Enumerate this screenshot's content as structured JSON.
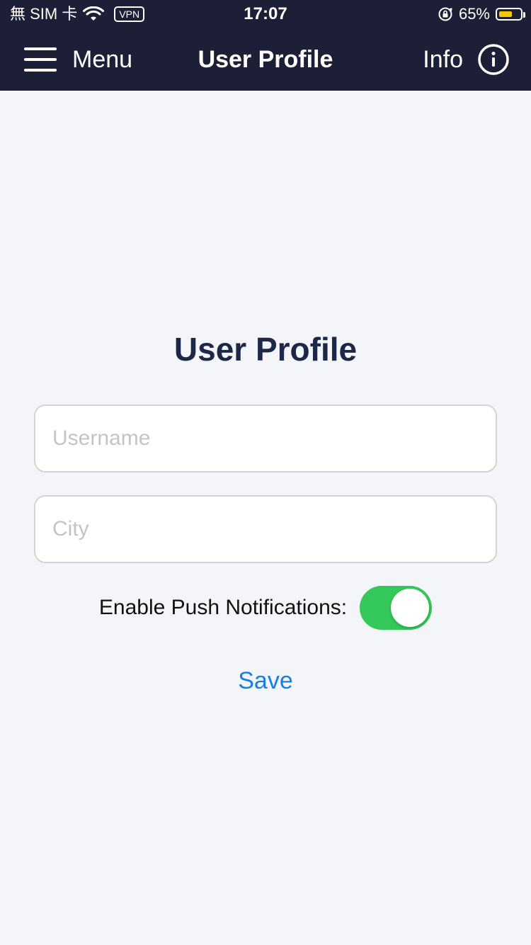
{
  "status_bar": {
    "carrier": "無 SIM 卡",
    "vpn": "VPN",
    "time": "17:07",
    "battery_percent": "65%",
    "battery_level": 0.65,
    "battery_color": "#f6c700"
  },
  "nav": {
    "menu_label": "Menu",
    "title": "User Profile",
    "info_label": "Info",
    "icons": {
      "menu": "hamburger-icon",
      "info": "info-circle-icon"
    }
  },
  "main": {
    "heading": "User Profile",
    "username_placeholder": "Username",
    "city_placeholder": "City",
    "push_label": "Enable Push Notifications:",
    "push_enabled": true,
    "save_label": "Save"
  },
  "colors": {
    "header_bg": "#1d1f36",
    "page_bg": "#f3f5f9",
    "toggle_on": "#34c759",
    "link": "#1a7ee6"
  }
}
